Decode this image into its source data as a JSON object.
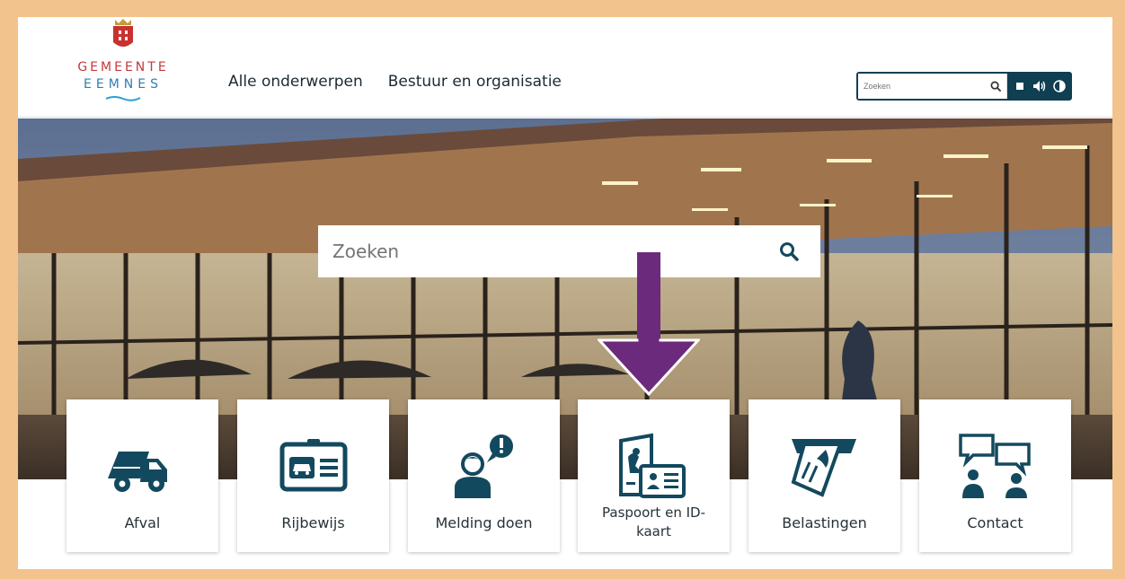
{
  "logo": {
    "line1": "GEMEENTE",
    "line2": "EEMNES"
  },
  "nav": [
    {
      "label": "Alle onderwerpen"
    },
    {
      "label": "Bestuur en organisatie"
    }
  ],
  "header_search": {
    "placeholder": "Zoeken",
    "icon": "search-icon"
  },
  "tools": [
    "stop-icon",
    "speaker-icon",
    "contrast-icon"
  ],
  "hero_search": {
    "placeholder": "Zoeken",
    "icon": "search-icon"
  },
  "annotation": {
    "color": "#6b2a7c",
    "icon": "down-arrow"
  },
  "colors": {
    "brand_dark": "#0f3f51",
    "icon_teal": "#13495e",
    "brand_red": "#c23a3e",
    "brand_blue": "#2f7db4"
  },
  "tiles": [
    {
      "label": "Afval",
      "icon": "garbage-truck-icon"
    },
    {
      "label": "Rijbewijs",
      "icon": "drivers-license-icon"
    },
    {
      "label": "Melding doen",
      "icon": "report-person-icon"
    },
    {
      "label": "Paspoort en ID-kaart",
      "icon": "passport-id-icon"
    },
    {
      "label": "Belastingen",
      "icon": "tax-bill-icon"
    },
    {
      "label": "Contact",
      "icon": "contact-people-icon"
    }
  ]
}
